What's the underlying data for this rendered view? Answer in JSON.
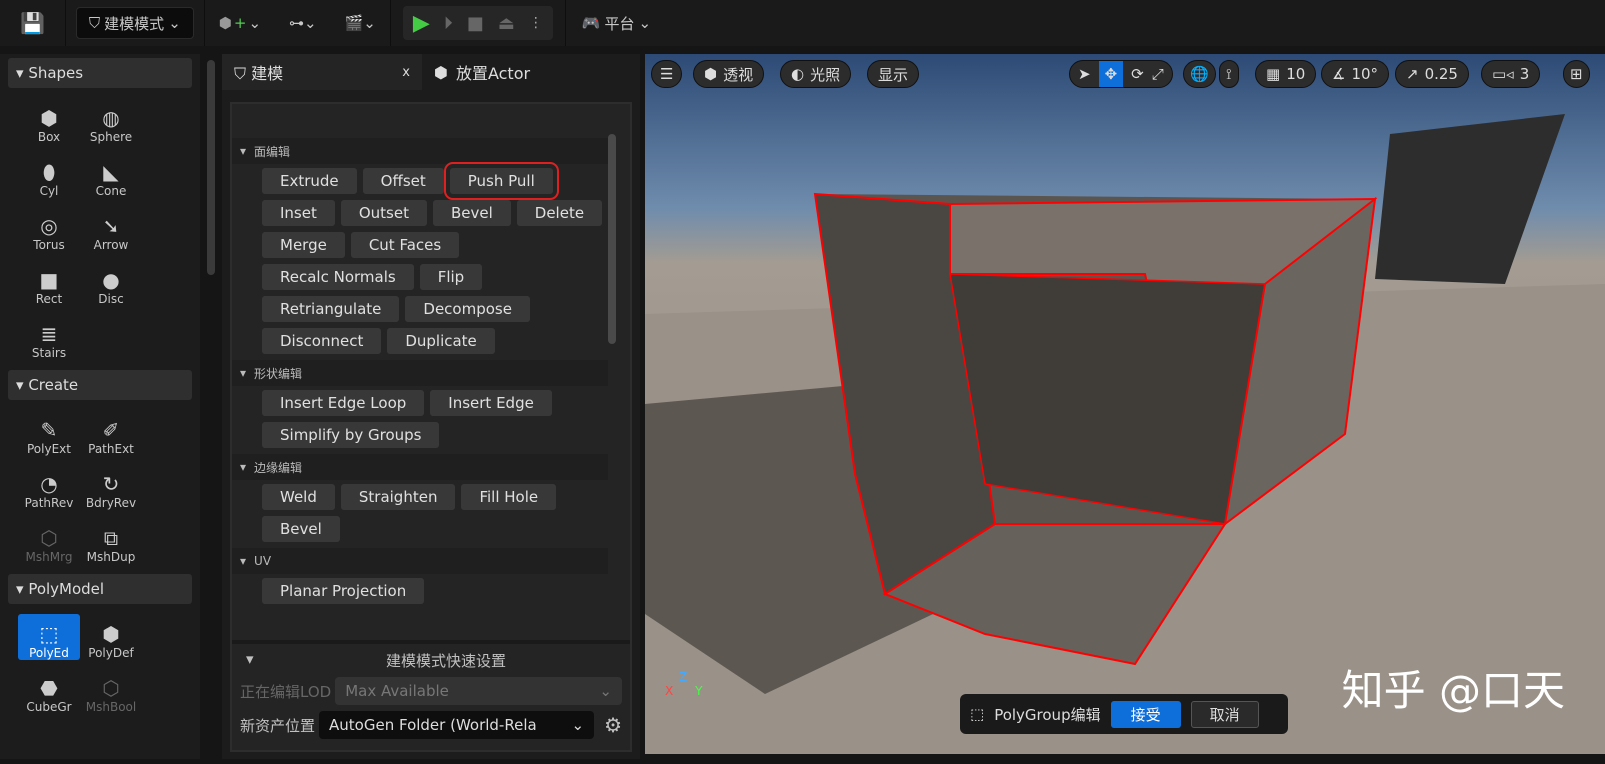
{
  "toolbar": {
    "mode": "建模模式",
    "platform": "平台"
  },
  "left": {
    "sections": [
      {
        "title": "Shapes",
        "tools": [
          "Box",
          "Sphere",
          "Cyl",
          "Cone",
          "Torus",
          "Arrow",
          "Rect",
          "Disc",
          "Stairs"
        ]
      },
      {
        "title": "Create",
        "tools": [
          "PolyExt",
          "PathExt",
          "PathRev",
          "BdryRev",
          "MshMrg",
          "MshDup"
        ]
      },
      {
        "title": "PolyModel",
        "tools": [
          "PolyEd",
          "PolyDef",
          "CubeGr",
          "MshBool"
        ]
      }
    ]
  },
  "tabs": {
    "modeling": "建模",
    "close": "x",
    "place": "放置Actor"
  },
  "groups": [
    {
      "title": "面编辑",
      "buttons": [
        "Extrude",
        "Offset",
        "Push Pull",
        "Inset",
        "Outset",
        "Bevel",
        "Delete",
        "Merge",
        "Cut Faces",
        "Recalc Normals",
        "Flip",
        "Retriangulate",
        "Decompose",
        "Disconnect",
        "Duplicate"
      ]
    },
    {
      "title": "形状编辑",
      "buttons": [
        "Insert Edge Loop",
        "Insert Edge",
        "Simplify by Groups"
      ]
    },
    {
      "title": "边缘编辑",
      "buttons": [
        "Weld",
        "Straighten",
        "Fill Hole",
        "Bevel"
      ]
    },
    {
      "title": "UV",
      "buttons": [
        "Planar Projection"
      ]
    }
  ],
  "quick": {
    "title": "建模模式快速设置",
    "lod_label": "正在编辑LOD",
    "lod_value": "Max Available",
    "asset_label": "新资产位置",
    "asset_value": "AutoGen Folder (World-Rela"
  },
  "viewport": {
    "perspective": "透视",
    "lighting": "光照",
    "show": "显示",
    "grid": "10",
    "angle": "10°",
    "scale": "0.25",
    "camera": "3",
    "axis": {
      "x": "X",
      "y": "Y",
      "z": "Z"
    },
    "bar": {
      "label": "PolyGroup编辑",
      "accept": "接受",
      "cancel": "取消"
    },
    "watermark": "知乎 @口天"
  },
  "colors": {
    "accent": "#0e6fdb",
    "highlight": "#e02020"
  }
}
